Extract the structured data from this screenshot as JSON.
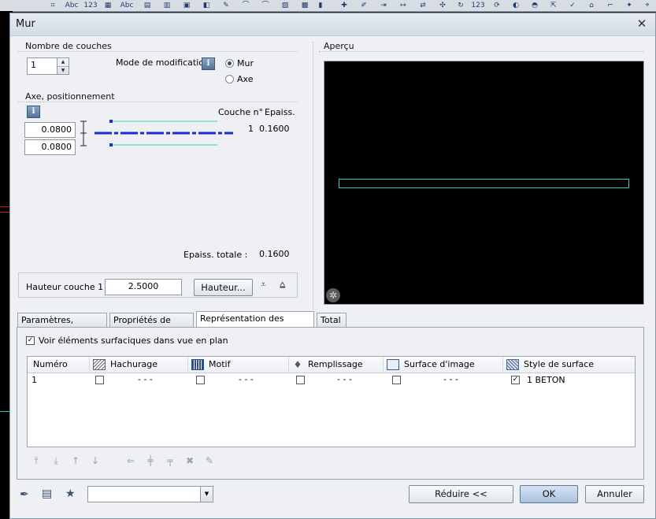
{
  "window": {
    "title": "Mur"
  },
  "layers": {
    "group_label": "Nombre de couches",
    "count": "1"
  },
  "modification": {
    "label": "Mode de modification",
    "options": [
      "Mur",
      "Axe"
    ],
    "selected": "Mur"
  },
  "axis": {
    "group_label": "Axe, positionnement",
    "value_top": "0.0800",
    "value_bottom": "0.0800",
    "col_layer": "Couche n°",
    "col_thickness": "Epaiss.",
    "row_num": "1",
    "row_thickness": "0.1600",
    "total_label": "Epaiss. totale :",
    "total_value": "0.1600"
  },
  "height": {
    "label": "Hauteur couche 1 :",
    "value": "2.5000",
    "button": "Hauteur..."
  },
  "preview": {
    "label": "Aperçu"
  },
  "tabs": [
    "Paramètres, attributs",
    "Propriétés de format",
    "Représentation des surfaces",
    "Total"
  ],
  "active_tab": "Représentation des surfaces",
  "surfaces": {
    "show_checkbox_label": "Voir éléments surfaciques dans vue en plan",
    "show_checked": true,
    "columns": [
      "Numéro",
      "Hachurage",
      "Motif",
      "Remplissage",
      "Surface d'image",
      "Style de surface"
    ],
    "rows": [
      {
        "num": "1",
        "hatch": "- - -",
        "pattern": "- - -",
        "fill": "- - -",
        "image": "- - -",
        "style": "1 BETON",
        "style_checked": true
      }
    ]
  },
  "footer": {
    "reduce": "Réduire <<",
    "ok": "OK",
    "cancel": "Annuler",
    "combo_value": ""
  },
  "colors": {
    "preview_bg": "#000000",
    "preview_line": "#3ec7c2",
    "axis_line": "#1b2bd6",
    "cyan_line": "#35d1cc"
  }
}
